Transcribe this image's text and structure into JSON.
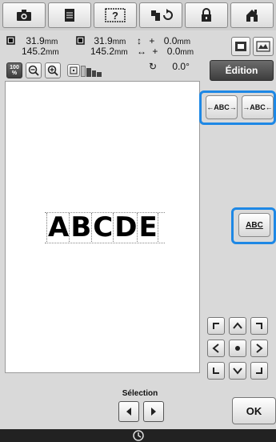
{
  "toolbar": {
    "buttons": [
      {
        "name": "camera-icon"
      },
      {
        "name": "document-icon"
      },
      {
        "name": "help-icon",
        "label": "?"
      },
      {
        "name": "embroidery-rotate-icon"
      },
      {
        "name": "lock-icon"
      },
      {
        "name": "home-icon"
      }
    ]
  },
  "info": {
    "size_width": "31.9",
    "size_height": "145.2",
    "unit": "mm",
    "size_width_2": "31.9",
    "size_height_2": "145.2",
    "offset_v": "0.0",
    "offset_h": "0.0",
    "offset_v_sign": "+",
    "offset_h_sign": "+",
    "rotation": "0.0°"
  },
  "zoom": {
    "level": "100",
    "unit": "%"
  },
  "edition_label": "Édition",
  "text_buttons": {
    "spacing_wide": "←ABC→",
    "spacing_narrow": "→ABC←",
    "alignment": "ABC"
  },
  "embroidery_text": [
    "A",
    "B",
    "C",
    "D",
    "E"
  ],
  "selection": {
    "label": "Sélection"
  },
  "ok_label": "OK",
  "colors": {
    "highlight": "#1e88e5",
    "edition_bg": "#4a4a4a"
  }
}
